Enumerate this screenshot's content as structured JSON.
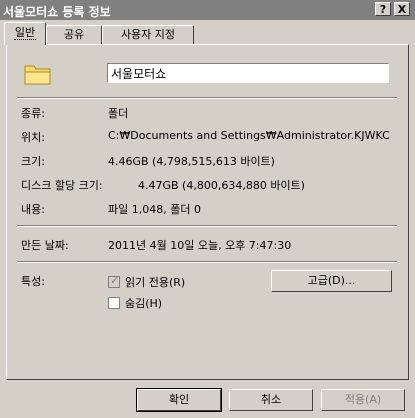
{
  "window": {
    "title": "서울모터쇼 등록 정보",
    "help_label": "?",
    "close_label": "X"
  },
  "tabs": [
    {
      "label": "일반",
      "active": true
    },
    {
      "label": "공유",
      "active": false
    },
    {
      "label": "사용자 지정",
      "active": false
    }
  ],
  "general": {
    "folder_name": "서울모터쇼",
    "type_label": "종류:",
    "type_value": "폴더",
    "location_label": "위치:",
    "location_value": "C:₩Documents and Settings₩Administrator.KJWKC",
    "size_label": "크기:",
    "size_value": "4.46GB (4,798,515,613 바이트)",
    "disk_size_label": "디스크 할당 크기:",
    "disk_size_value": "4.47GB (4,800,634,880 바이트)",
    "contents_label": "내용:",
    "contents_value": "파일 1,048, 폴더 0",
    "created_label": "만든 날짜:",
    "created_value": "2011년 4월 10일 오늘, 오후 7:47:30",
    "attributes_label": "특성:",
    "readonly_label": "읽기 전용(R)",
    "readonly_checked": true,
    "hidden_label": "숨김(H)",
    "hidden_checked": false,
    "advanced_label": "고급(D)..."
  },
  "buttons": {
    "ok": "확인",
    "cancel": "취소",
    "apply": "적용(A)"
  },
  "colors": {
    "face": "#d4d0c8",
    "titlebar": "#808080",
    "folder": "#f5d96b"
  }
}
